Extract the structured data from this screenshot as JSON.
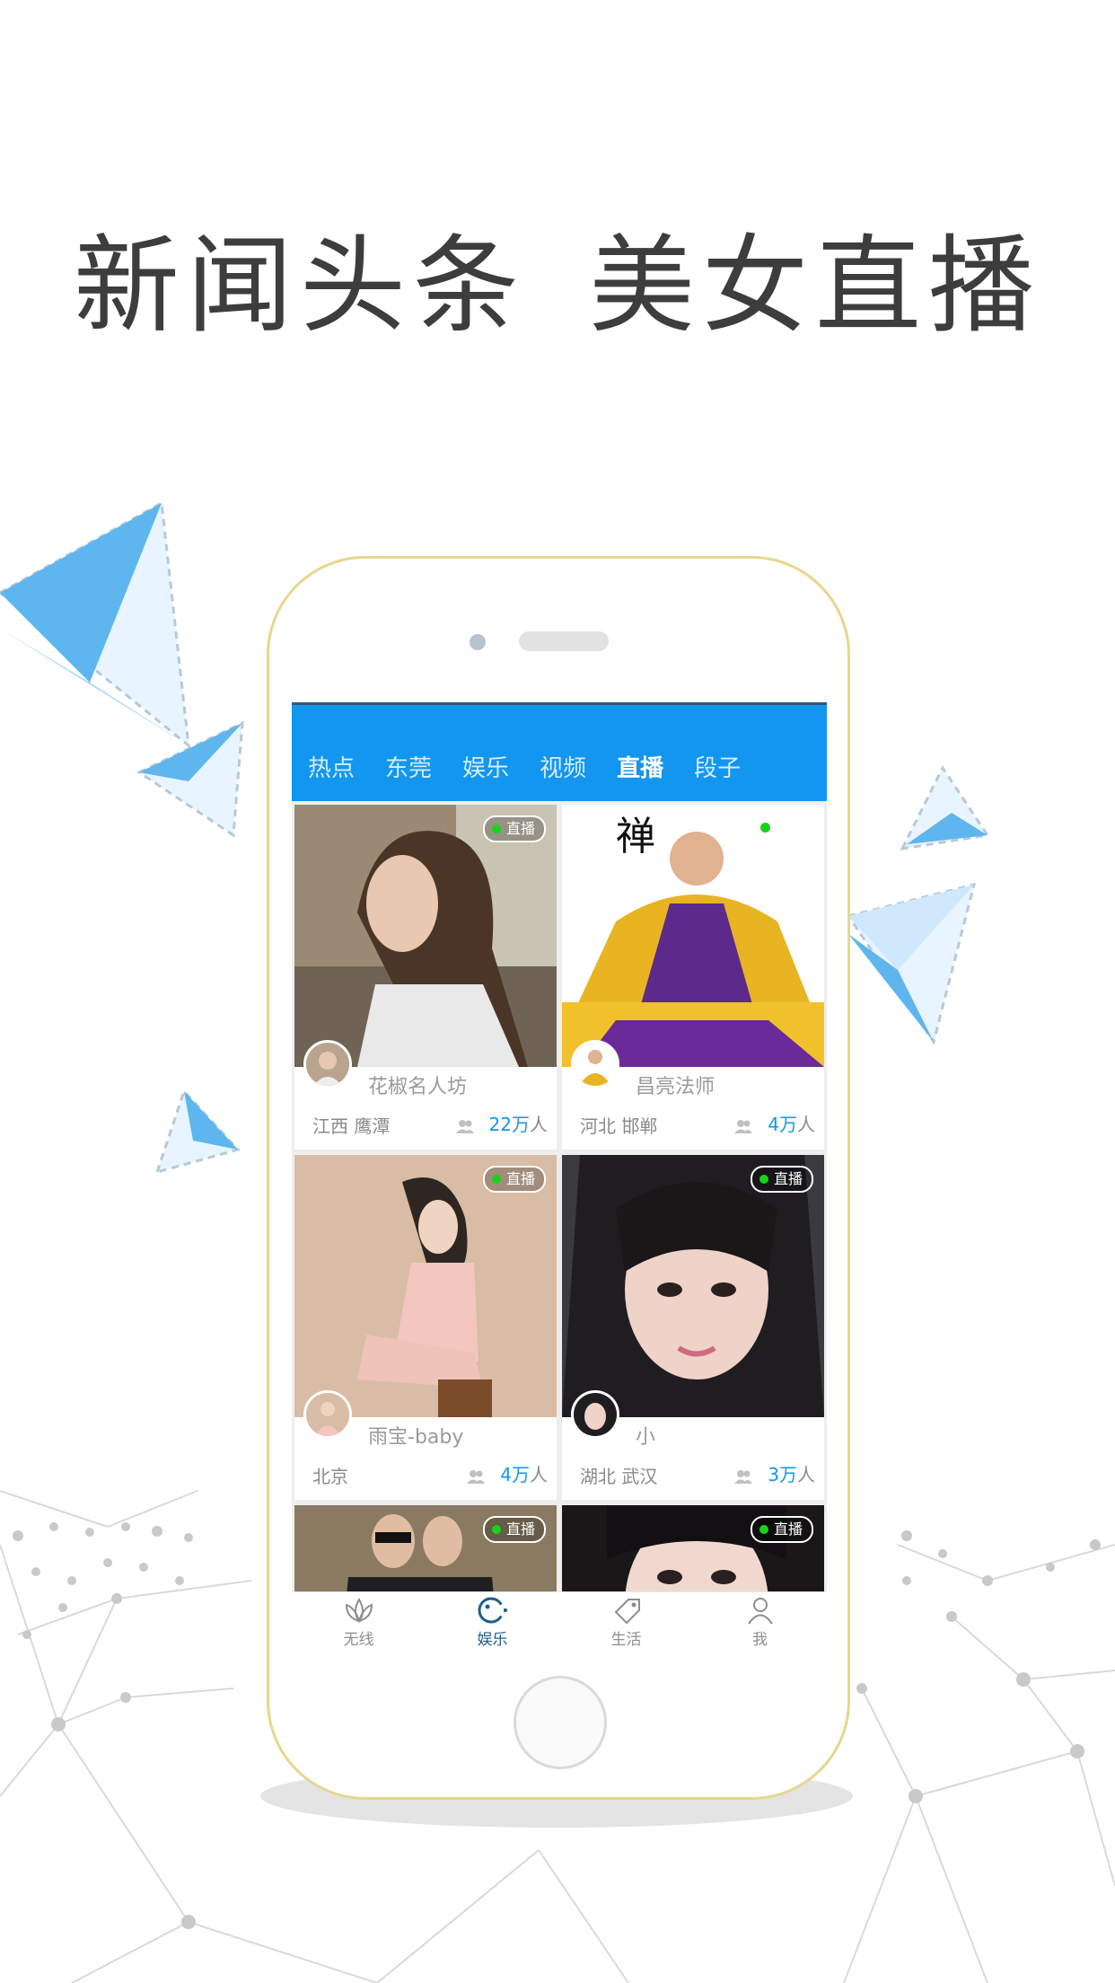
{
  "headline": {
    "left": "新闻头条",
    "right": "美女直播"
  },
  "colors": {
    "accent": "#1296f0",
    "live_dot": "#19d219",
    "phone_frame": "#e6d78e"
  },
  "tabs": [
    {
      "label": "热点",
      "active": false
    },
    {
      "label": "东莞",
      "active": false
    },
    {
      "label": "娱乐",
      "active": false
    },
    {
      "label": "视频",
      "active": false
    },
    {
      "label": "直播",
      "active": true
    },
    {
      "label": "段子",
      "active": false
    }
  ],
  "cards": [
    {
      "live_label": "直播",
      "name": "花椒名人坊",
      "location": "江西 鹰潭",
      "viewers": "22万",
      "viewers_unit": "人"
    },
    {
      "live_label": "",
      "name": "昌亮法师",
      "location": "河北 邯郸",
      "viewers": "4万",
      "viewers_unit": "人",
      "photo_text": "禅"
    },
    {
      "live_label": "直播",
      "name": "雨宝-baby",
      "location": "北京",
      "viewers": "4万",
      "viewers_unit": "人"
    },
    {
      "live_label": "直播",
      "name": "小",
      "location": "湖北 武汉",
      "viewers": "3万",
      "viewers_unit": "人"
    },
    {
      "live_label": "直播",
      "name": "",
      "location": "",
      "viewers": "",
      "viewers_unit": ""
    },
    {
      "live_label": "直播",
      "name": "",
      "location": "",
      "viewers": "",
      "viewers_unit": ""
    }
  ],
  "tabbar": [
    {
      "label": "无线",
      "icon": "lotus-icon",
      "active": false
    },
    {
      "label": "娱乐",
      "icon": "gamepad-icon",
      "active": true
    },
    {
      "label": "生活",
      "icon": "tag-icon",
      "active": false
    },
    {
      "label": "我",
      "icon": "person-icon",
      "active": false
    }
  ]
}
